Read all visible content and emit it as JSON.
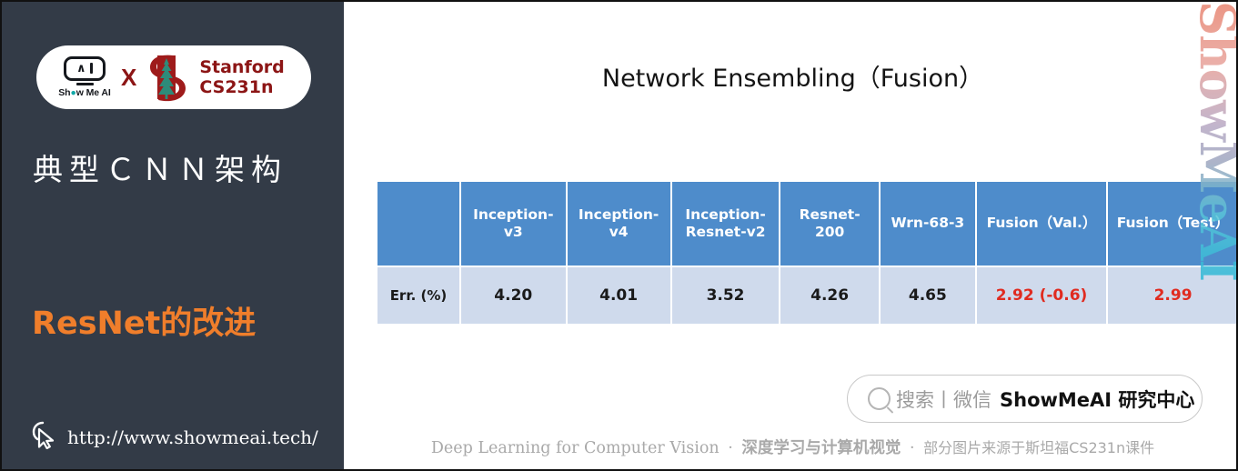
{
  "sidebar": {
    "badge": {
      "showmeai_label": "Show Me AI",
      "x_label": "X",
      "stanford_line1": "Stanford",
      "stanford_line2": "CS231n",
      "monitor_caret": "∧",
      "icon_names": [
        "showmeai-logo-icon",
        "cross-icon",
        "stanford-tree-icon"
      ]
    },
    "title": "典型ＣＮＮ架构",
    "subtitle": "ResNet的改进",
    "url": "http://www.showmeai.tech/",
    "cursor_icon": "cursor-click-icon",
    "background_color": "#333b47",
    "accent_color": "#F07E2B"
  },
  "main": {
    "title": "Network Ensembling（Fusion）",
    "watermark": "ShowMeAI",
    "table": {
      "header_color": "#4E8CCB",
      "row_color": "#CFDAEC",
      "highlight_color": "#E02B20",
      "columns": [
        "",
        "Inception-v3",
        "Inception-v4",
        "Inception-Resnet-v2",
        "Resnet-200",
        "Wrn-68-3",
        "Fusion（Val.）",
        "Fusion（Test）"
      ],
      "columns_lines": [
        [
          "",
          ""
        ],
        [
          "Inception-",
          "v3"
        ],
        [
          "Inception-",
          "v4"
        ],
        [
          "Inception-",
          "Resnet-v2"
        ],
        [
          "Resnet-",
          "200"
        ],
        [
          "Wrn-68-3",
          ""
        ],
        [
          "Fusion（Val.）",
          ""
        ],
        [
          "Fusion（Test）",
          ""
        ]
      ],
      "rows": [
        {
          "label": "Err. (%)",
          "values": [
            "4.20",
            "4.01",
            "3.52",
            "4.26",
            "4.65",
            "2.92 (-0.6)",
            "2.99"
          ],
          "highlighted": [
            false,
            false,
            false,
            false,
            false,
            true,
            true
          ]
        }
      ]
    },
    "search": {
      "icon": "search-icon",
      "gray_text": "搜索丨微信",
      "bold_text": "ShowMeAI 研究中心"
    },
    "footer": {
      "en": "Deep Learning for Computer Vision",
      "sep": "·",
      "cn_bold": "深度学习与计算机视觉",
      "tail": "部分图片来源于斯坦福CS231n课件"
    }
  }
}
